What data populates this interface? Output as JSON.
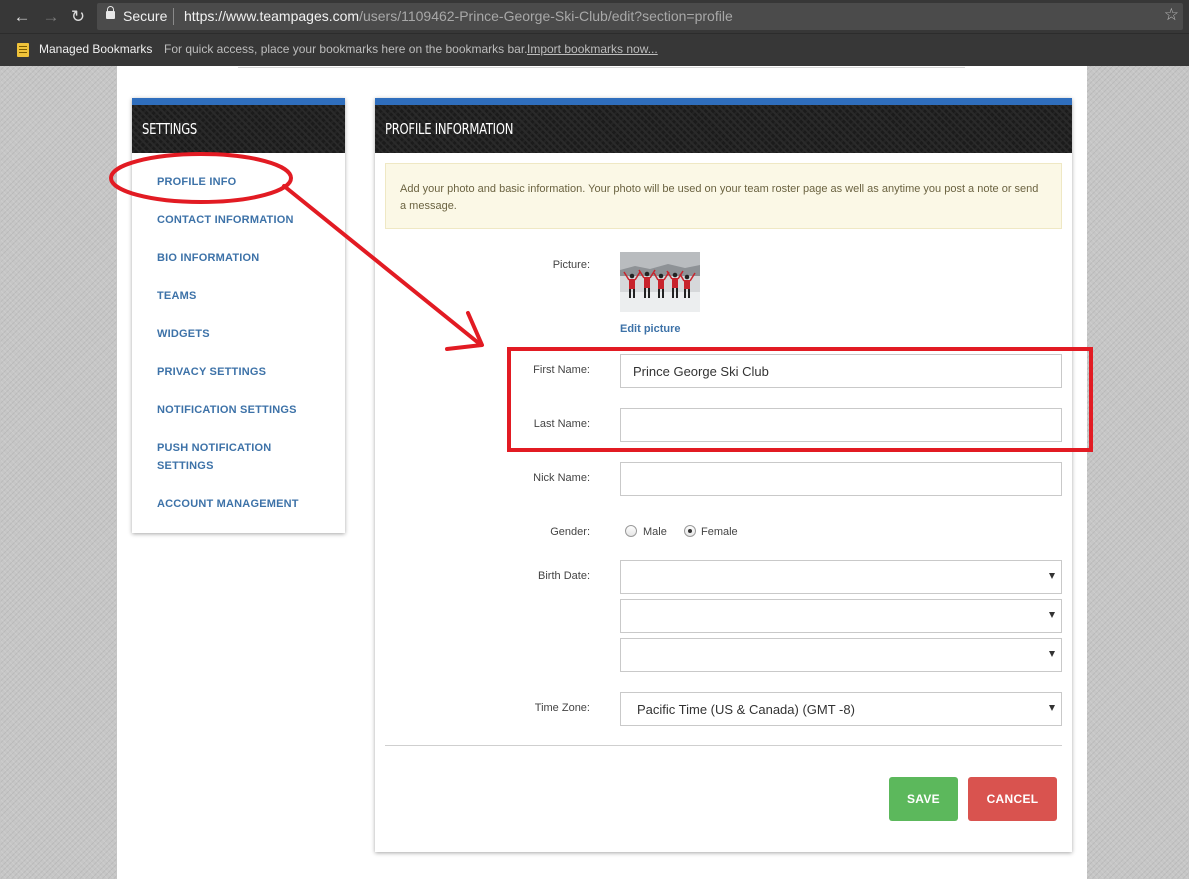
{
  "browser": {
    "secure_label": "Secure",
    "url_scheme_host": "https://www.teampages.com",
    "url_path": "/users/1109462-Prince-George-Ski-Club/edit?section=profile",
    "bookmarks_folder": "Managed Bookmarks",
    "bookmarks_hint": "For quick access, place your bookmarks here on the bookmarks bar.",
    "import_link": "Import bookmarks now..."
  },
  "sidebar": {
    "title": "SETTINGS",
    "items": [
      {
        "label": "PROFILE INFO"
      },
      {
        "label": "CONTACT INFORMATION"
      },
      {
        "label": "BIO INFORMATION"
      },
      {
        "label": "TEAMS"
      },
      {
        "label": "WIDGETS"
      },
      {
        "label": "PRIVACY SETTINGS"
      },
      {
        "label": "NOTIFICATION SETTINGS"
      },
      {
        "label": "PUSH NOTIFICATION SETTINGS"
      },
      {
        "label": "ACCOUNT MANAGEMENT"
      }
    ]
  },
  "profile": {
    "title": "PROFILE INFORMATION",
    "notice": "Add your photo and basic information. Your photo will be used on your team roster page as well as anytime you post a note or send a message.",
    "picture_label": "Picture:",
    "edit_picture": "Edit picture",
    "first_name_label": "First Name:",
    "first_name_value": "Prince George Ski Club",
    "last_name_label": "Last Name:",
    "last_name_value": "",
    "nick_name_label": "Nick Name:",
    "nick_name_value": "",
    "gender_label": "Gender:",
    "gender_options": [
      "Male",
      "Female"
    ],
    "gender_selected": "Female",
    "birth_date_label": "Birth Date:",
    "birth_month": "",
    "birth_day": "",
    "birth_year": "",
    "time_zone_label": "Time Zone:",
    "time_zone_value": "Pacific Time (US & Canada) (GMT -8)",
    "save_label": "SAVE",
    "cancel_label": "CANCEL"
  },
  "colors": {
    "accent_blue": "#2f6ebd",
    "link_blue": "#3d72a8",
    "save_green": "#5cb85c",
    "cancel_red": "#d9534f",
    "annotation_red": "#e21b23"
  }
}
